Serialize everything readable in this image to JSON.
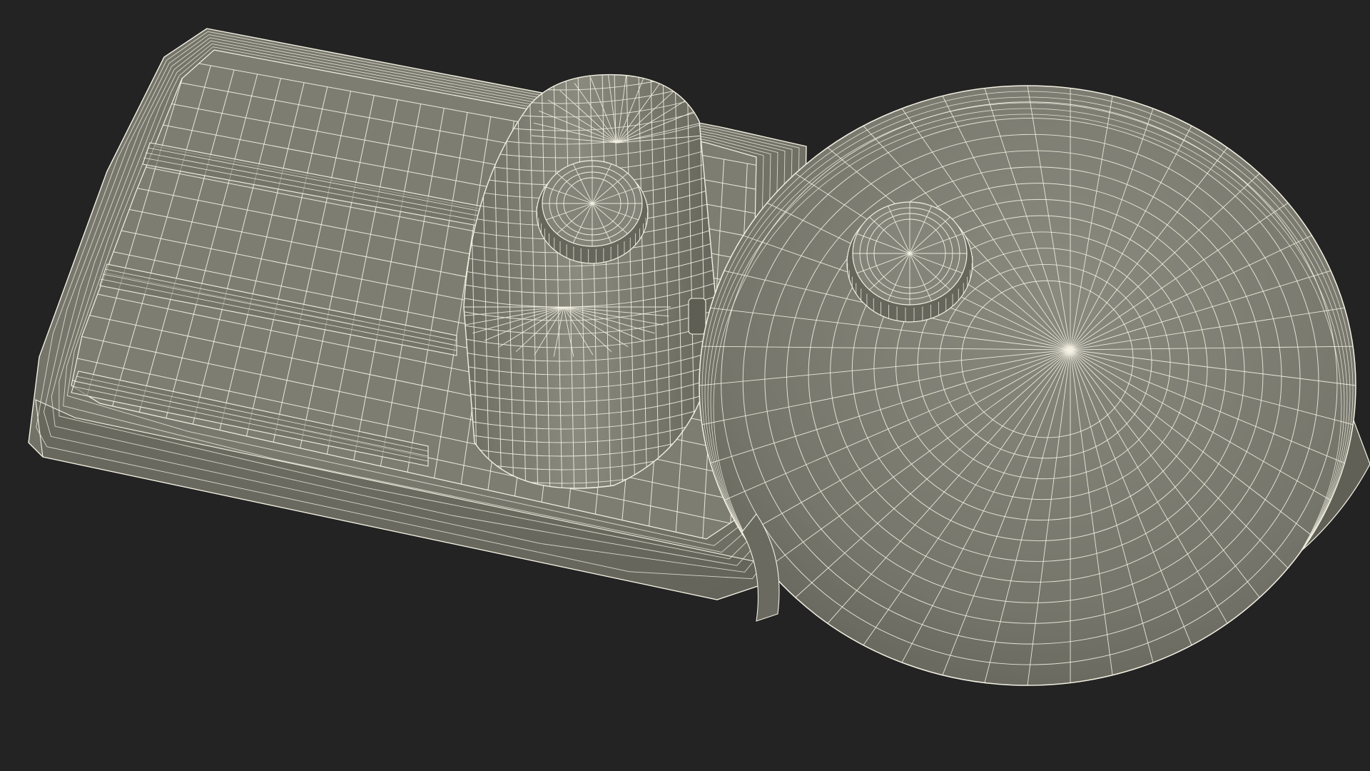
{
  "scene": {
    "background_color": "#232323",
    "surface_color": "#7b7b70",
    "surface_shadow_color": "#5f5f56",
    "surface_highlight_color": "#8b8b80",
    "wire_color": "#f4f1e3",
    "render_mode": "wireframe-on-shaded",
    "object": "3d-model-part"
  }
}
